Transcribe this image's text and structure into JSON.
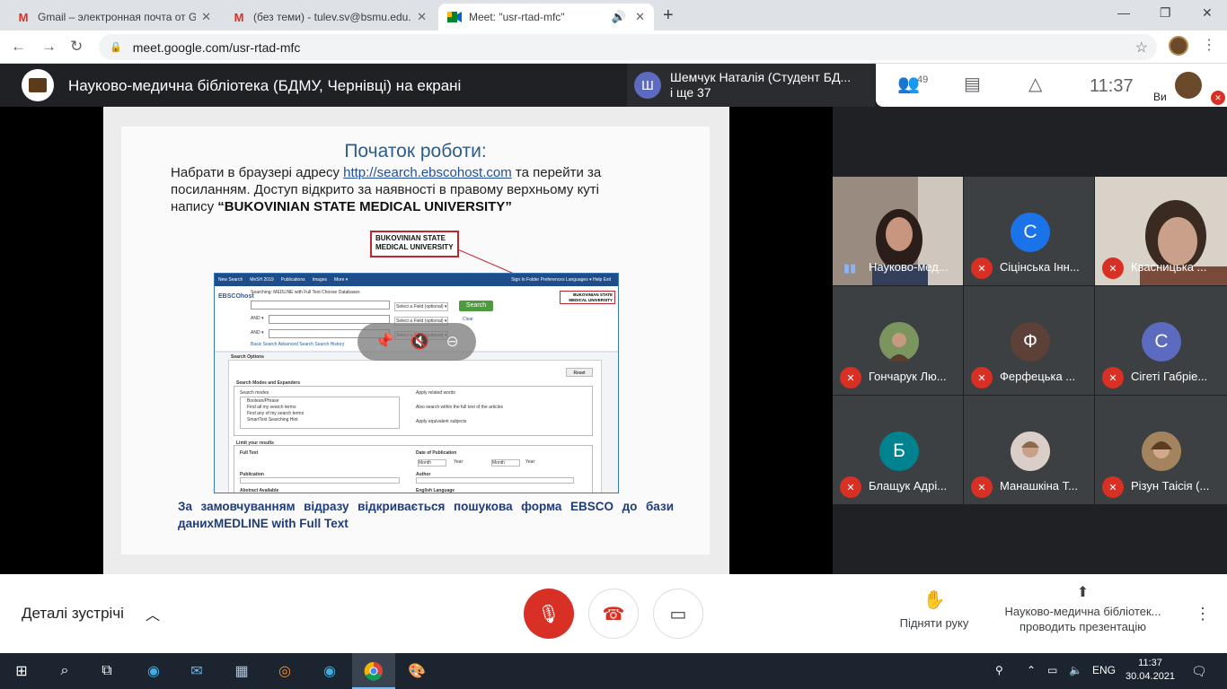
{
  "tabs": [
    {
      "title": "Gmail – электронная почта от G",
      "icon": "gmail-icon",
      "active": false
    },
    {
      "title": "(без теми) - tulev.sv@bsmu.edu.",
      "icon": "gmail-icon",
      "active": false
    },
    {
      "title": "Meet: \"usr-rtad-mfc\"",
      "icon": "meet-icon",
      "active": true
    }
  ],
  "address": {
    "url": "meet.google.com/usr-rtad-mfc"
  },
  "header": {
    "presentation_title": "Науково-медична бібліотека (БДМУ, Чернівці) на екрані",
    "speaker_initial": "Ш",
    "speaker_name": "Шемчук Наталія (Студент БД...",
    "speaker_more": "і ще 37",
    "participant_count": "49",
    "time": "11:37",
    "self_label": "Ви"
  },
  "slide": {
    "title": "Початок роботи:",
    "line1_pre": "Набрати в браузері адресу ",
    "link": "http://search.ebscohost.com",
    "line1_post": " та перейти за посиланням. Доступ відкрито за наявності в правому верхньому куті напису ",
    "quote": "“BUKOVINIAN STATE MEDICAL UNIVERSITY”",
    "callout": "BUKOVINIAN STATE MEDICAL UNIVERSITY",
    "footer_line1": "За замовчуванням відразу відкривається пошукова форма EBSCO до бази",
    "footer_line2": "данихMEDLINE with Full Text"
  },
  "ebsco": {
    "nav": [
      "New Search",
      "MeSH 2019",
      "Publications",
      "Images",
      "More ▾"
    ],
    "nav_right": "Sign In   Folder   Preferences   Languages ▾   Help   Exit",
    "logo": "EBSCOhost",
    "searching": "Searching: MEDLINE with Full Text   Choose Databases",
    "field": "Select a Field (optional) ▾",
    "search_btn": "Search",
    "and": "AND ▾",
    "clear": "Clear",
    "links": "Basic Search   Advanced Search   Search History",
    "badge": "BUKOVINIAN STATE MEDICAL UNIVERSITY",
    "search_options": "Search Options",
    "reset": "Reset",
    "modes_title": "Search Modes and Expanders",
    "search_modes": "Search modes",
    "modes": [
      "Boolean/Phrase",
      "Find all my search terms",
      "Find any of my search terms",
      "SmartText Searching  Hint"
    ],
    "apply_related": "Apply related words",
    "also_search": "Also search within the full text of the articles",
    "apply_equiv": "Apply equivalent subjects",
    "limit": "Limit your results",
    "full_text": "Full Text",
    "date_pub": "Date of Publication",
    "month": "Month",
    "year": "Year:",
    "publication": "Publication",
    "author": "Author",
    "abstract": "Abstract Available",
    "english": "English Language"
  },
  "participants": [
    {
      "name": "Науково-мед...",
      "initial": "",
      "color": "",
      "muted": false,
      "photo": true
    },
    {
      "name": "Сіцінська Інн...",
      "initial": "С",
      "color": "#1a73e8",
      "muted": true,
      "photo": false
    },
    {
      "name": "Квасницька ...",
      "initial": "",
      "color": "",
      "muted": true,
      "photo": true
    },
    {
      "name": "Гончарук Лю...",
      "initial": "",
      "color": "#6e8b5a",
      "muted": true,
      "photo": true
    },
    {
      "name": "Ферфецька ...",
      "initial": "Ф",
      "color": "#5d4037",
      "muted": true,
      "photo": false
    },
    {
      "name": "Сігеті Габріе...",
      "initial": "С",
      "color": "#5c6bc0",
      "muted": true,
      "photo": false
    },
    {
      "name": "Блащук Адрі...",
      "initial": "Б",
      "color": "#00838f",
      "muted": true,
      "photo": false
    },
    {
      "name": "Манашкіна Т...",
      "initial": "",
      "color": "#b08f7a",
      "muted": true,
      "photo": true
    },
    {
      "name": "Різун Таісія (...",
      "initial": "",
      "color": "#8d6e4a",
      "muted": true,
      "photo": true
    }
  ],
  "bottom": {
    "details": "Деталі зустрічі",
    "raise_hand": "Підняти руку",
    "presenting_line1": "Науково-медична бібліотек...",
    "presenting_line2": "проводить презентацію"
  },
  "taskbar": {
    "lang": "ENG",
    "time": "11:37",
    "date": "30.04.2021"
  },
  "colors": {
    "accent_red": "#d93025",
    "meet_bg": "#202124",
    "blue_link": "#1f4e9b"
  }
}
